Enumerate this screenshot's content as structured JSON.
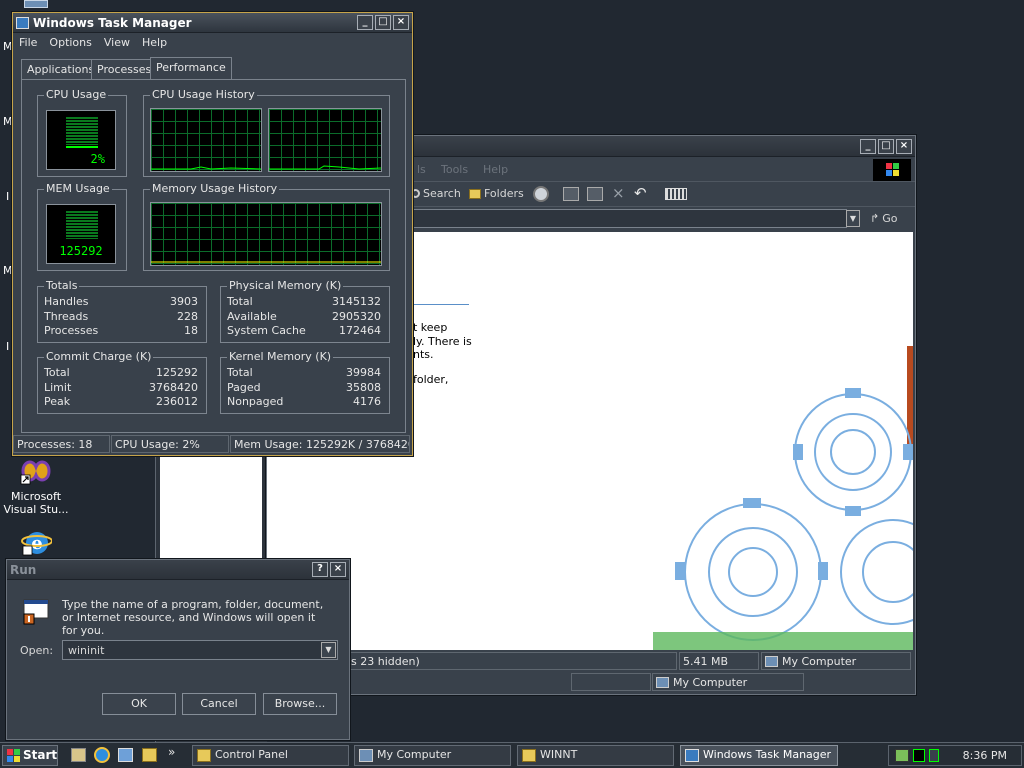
{
  "colors": {
    "desktop": "#212831",
    "graph_green": "#00ff00",
    "grid_green": "#0b6b2a",
    "accent_orange": "#b84a1f"
  },
  "desktop_icons": [
    {
      "label": "Microsoft Visual Stu...",
      "icon": "visual-studio-icon"
    },
    {
      "label": "",
      "icon": "internet-explorer-icon"
    }
  ],
  "task_manager": {
    "title": "Windows Task Manager",
    "menu": [
      "File",
      "Options",
      "View",
      "Help"
    ],
    "tabs": [
      "Applications",
      "Processes",
      "Performance"
    ],
    "active_tab": "Performance",
    "cpu_usage_label": "CPU Usage",
    "cpu_usage_value": "2%",
    "cpu_history_label": "CPU Usage History",
    "mem_usage_label": "MEM Usage",
    "mem_usage_value": "125292",
    "mem_history_label": "Memory Usage History",
    "totals": {
      "label": "Totals",
      "rows": [
        [
          "Handles",
          "3903"
        ],
        [
          "Threads",
          "228"
        ],
        [
          "Processes",
          "18"
        ]
      ]
    },
    "physical_memory": {
      "label": "Physical Memory (K)",
      "rows": [
        [
          "Total",
          "3145132"
        ],
        [
          "Available",
          "2905320"
        ],
        [
          "System Cache",
          "172464"
        ]
      ]
    },
    "commit_charge": {
      "label": "Commit Charge (K)",
      "rows": [
        [
          "Total",
          "125292"
        ],
        [
          "Limit",
          "3768420"
        ],
        [
          "Peak",
          "236012"
        ]
      ]
    },
    "kernel_memory": {
      "label": "Kernel Memory (K)",
      "rows": [
        [
          "Total",
          "39984"
        ],
        [
          "Paged",
          "35808"
        ],
        [
          "Nonpaged",
          "4176"
        ]
      ]
    },
    "status": {
      "processes": "Processes: 18",
      "cpu": "CPU Usage: 2%",
      "mem": "Mem Usage: 125292K / 3768420K"
    }
  },
  "explorer": {
    "menu_partial": [
      "ls",
      "Tools",
      "Help"
    ],
    "toolbar": {
      "search": "Search",
      "folders": "Folders"
    },
    "go_label": "Go",
    "body_text_lines": [
      "t keep",
      "ly. There is",
      "nts.",
      "folder,"
    ],
    "status": {
      "left": "s 23 hidden)",
      "size": "5.41 MB",
      "location": "My Computer"
    },
    "status2": {
      "location": "My Computer"
    }
  },
  "run_dialog": {
    "title": "Run",
    "description": "Type the name of a program, folder, document, or Internet resource, and Windows will open it for you.",
    "open_label": "Open:",
    "open_value": "wininit",
    "buttons": {
      "ok": "OK",
      "cancel": "Cancel",
      "browse": "Browse..."
    }
  },
  "taskbar": {
    "start": "Start",
    "tasks": [
      "Control Panel",
      "My Computer",
      "WINNT",
      "Windows Task Manager"
    ],
    "clock": "8:36 PM"
  }
}
